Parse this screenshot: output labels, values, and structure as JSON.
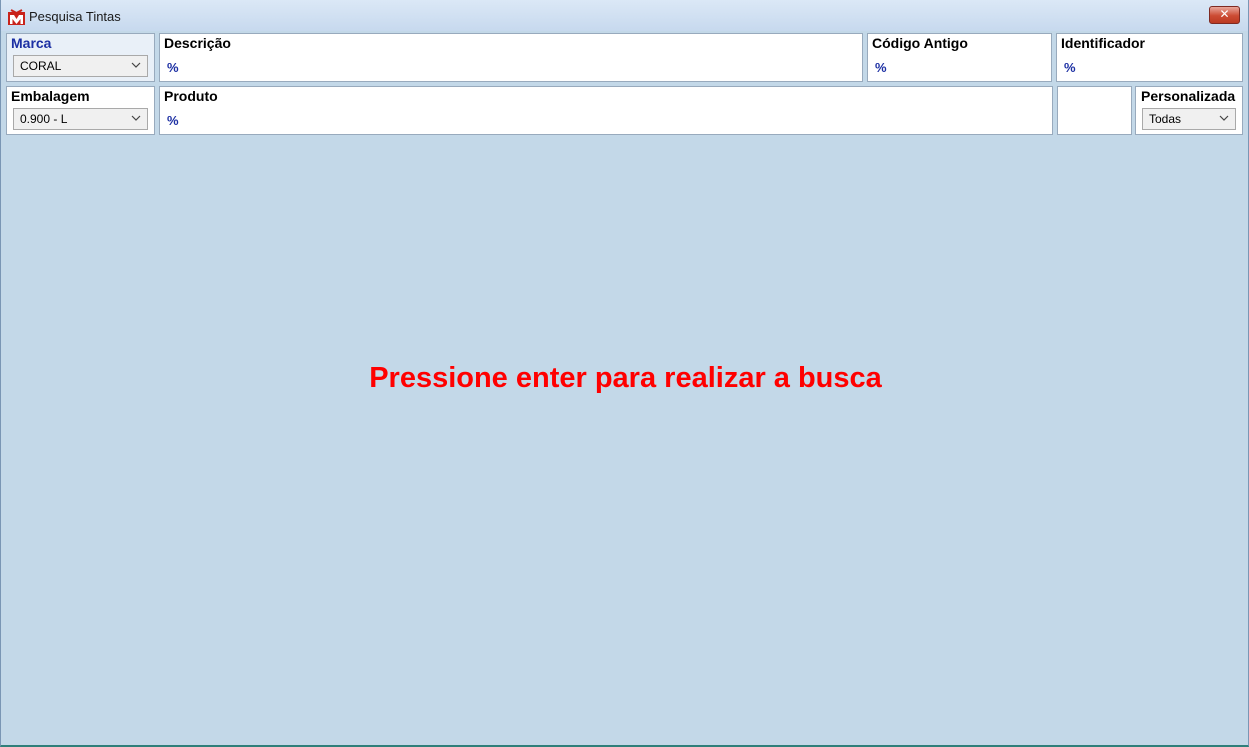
{
  "window": {
    "title": "Pesquisa Tintas",
    "close_label": "✕"
  },
  "filters": {
    "marca": {
      "label": "Marca",
      "value": "CORAL"
    },
    "descricao": {
      "label": "Descrição",
      "value": "%"
    },
    "codigo_antigo": {
      "label": "Código Antigo",
      "value": "%"
    },
    "identificador": {
      "label": "Identificador",
      "value": "%"
    },
    "embalagem": {
      "label": "Embalagem",
      "value": "0.900 - L"
    },
    "produto": {
      "label": "Produto",
      "value": "%"
    },
    "personalizada": {
      "label": "Personalizada",
      "value": "Todas"
    }
  },
  "message": "Pressione enter para realizar a busca",
  "colors": {
    "background": "#c3d8e8",
    "message": "#ff0000",
    "label_accent": "#1c2fa3"
  },
  "icons": {
    "app": "paint-brand-icon",
    "close": "close-icon",
    "dropdown": "chevron-down-icon"
  }
}
